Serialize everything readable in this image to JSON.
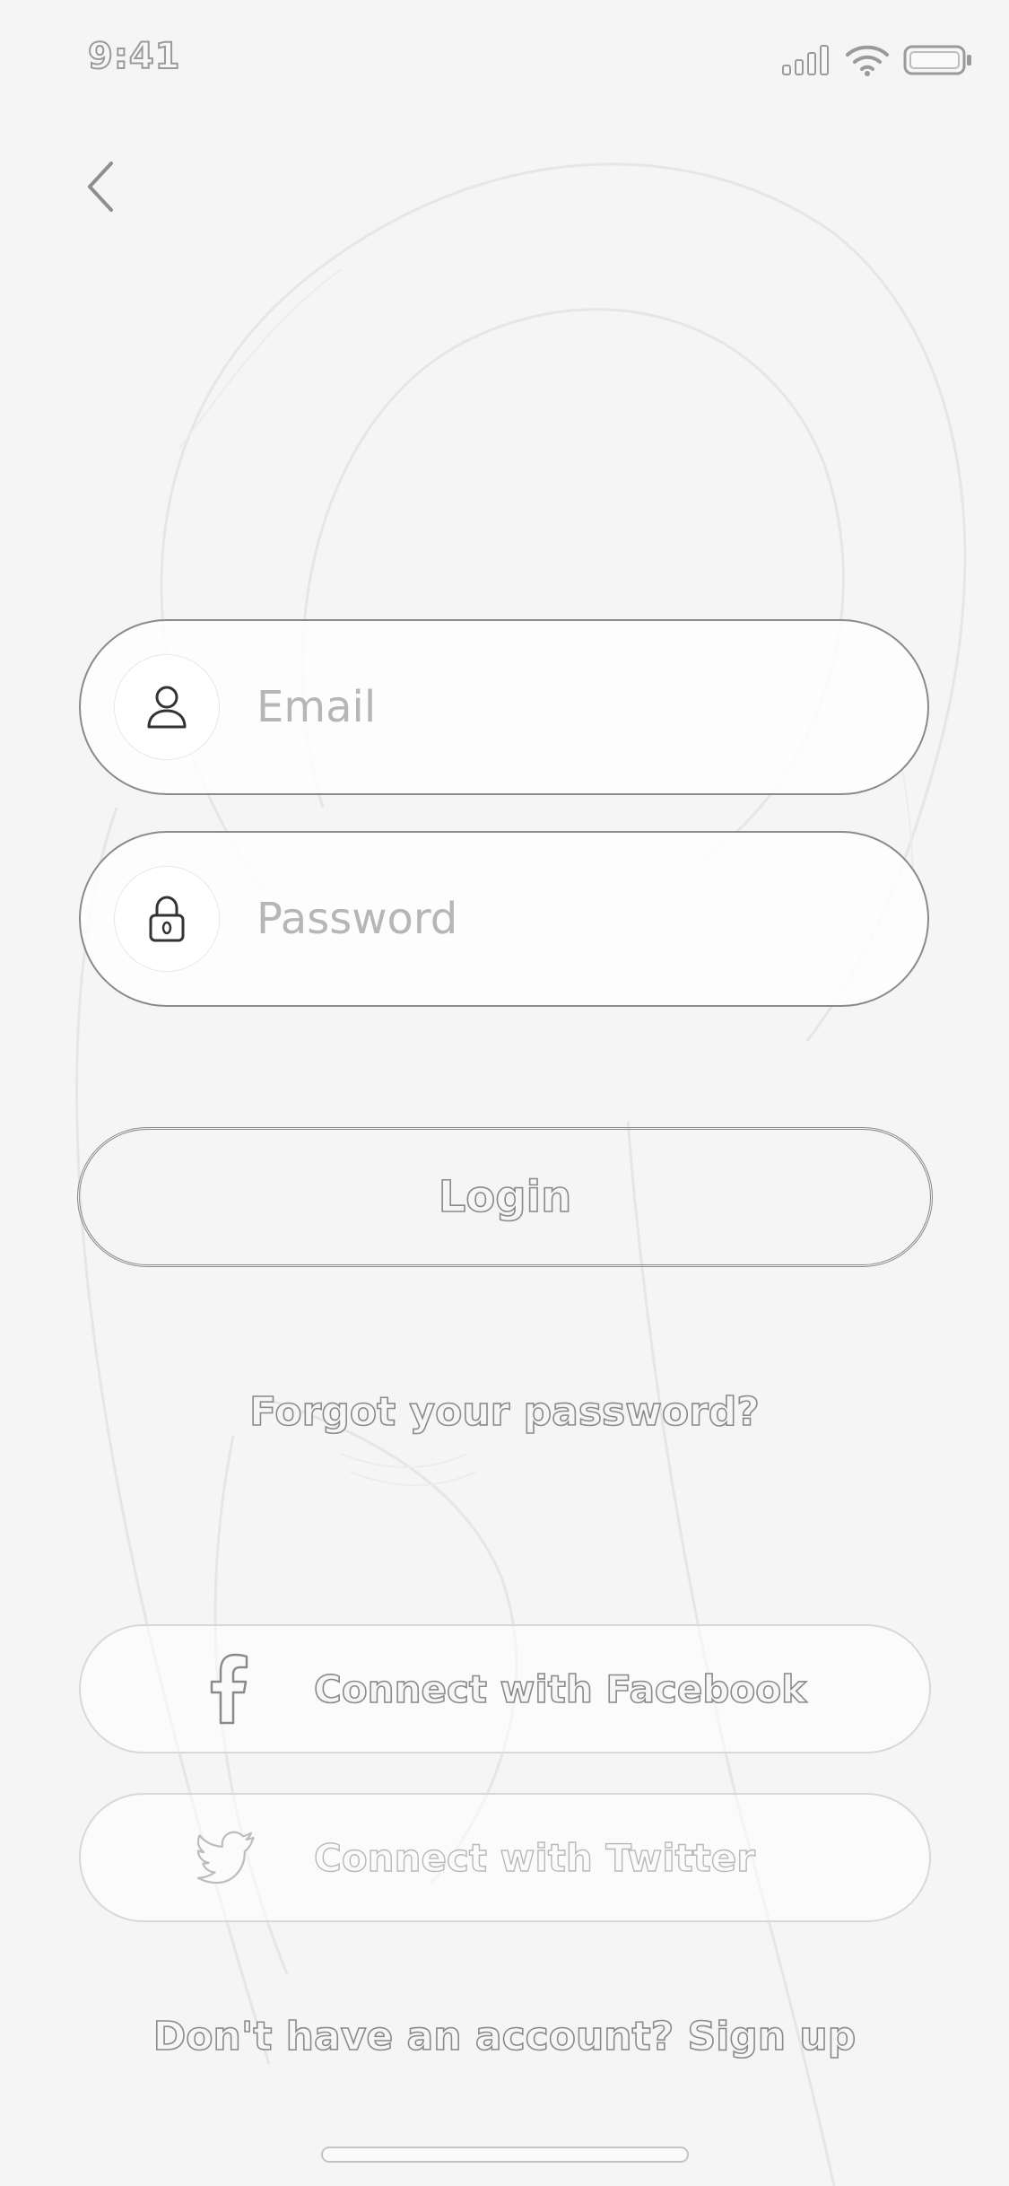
{
  "status_bar": {
    "time": "9:41",
    "icons": [
      "signal-icon",
      "wifi-icon",
      "battery-icon"
    ]
  },
  "nav": {
    "back_icon": "chevron-left-icon"
  },
  "form": {
    "email": {
      "placeholder": "Email",
      "value": "",
      "icon": "user-icon"
    },
    "password": {
      "placeholder": "Password",
      "value": "",
      "icon": "lock-icon"
    },
    "login_label": "Login",
    "forgot_label": "Forgot your password?"
  },
  "social": {
    "facebook_label": "Connect with Facebook",
    "facebook_icon": "facebook-icon",
    "twitter_label": "Connect with Twitter",
    "twitter_icon": "twitter-icon"
  },
  "footer": {
    "signup_label": "Don't have an account? Sign up"
  },
  "colors": {
    "background": "#f5f5f5",
    "outline": "#8a8a8a",
    "placeholder": "#b6b6b6"
  }
}
